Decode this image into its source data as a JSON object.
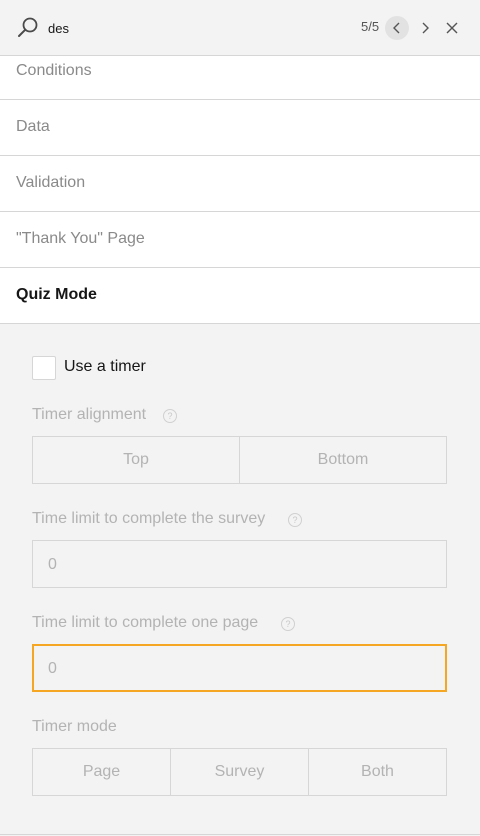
{
  "search": {
    "value": "des",
    "count": "5/5"
  },
  "sections": {
    "conditions": "Conditions",
    "data": "Data",
    "validation": "Validation",
    "thank_you": "\"Thank You\" Page",
    "quiz": "Quiz Mode"
  },
  "quiz_panel": {
    "use_timer_label": "Use a timer",
    "use_timer_checked": false,
    "timer_alignment": {
      "label": "Timer alignment",
      "options": [
        "Top",
        "Bottom"
      ]
    },
    "time_limit_survey": {
      "label": "Time limit to complete the survey",
      "value": "0"
    },
    "time_limit_page": {
      "label": "Time limit to complete one page",
      "value": "0"
    },
    "timer_mode": {
      "label": "Timer mode",
      "options": [
        "Page",
        "Survey",
        "Both"
      ]
    },
    "help_glyph": "?"
  },
  "icons": {
    "search": "search-icon",
    "prev": "chevron-left-icon",
    "next": "chevron-right-icon",
    "close": "close-icon",
    "help": "help-icon"
  },
  "colors": {
    "focus_border": "#f5a623",
    "disabled_text": "#b3b3b3",
    "border": "#d6d6d6"
  }
}
